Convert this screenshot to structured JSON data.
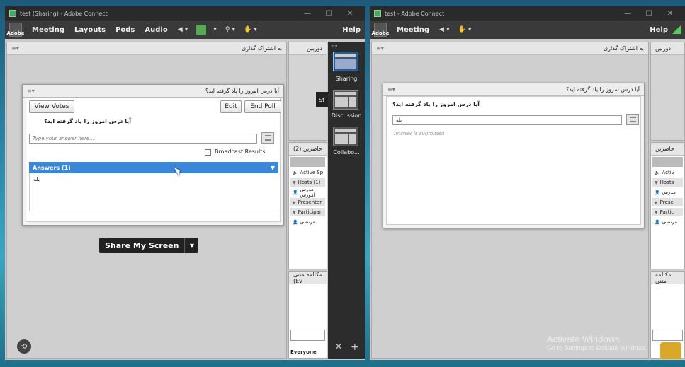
{
  "left_window": {
    "title": "test (Sharing) - Adobe Connect",
    "menu": [
      "Meeting",
      "Layouts",
      "Pods",
      "Audio"
    ],
    "help": "Help",
    "share_pod_title": "به اشتراک گذاری",
    "video_pod_title": "دوربين",
    "poll": {
      "title": "آیا درس امروز را یاد گرفته اید؟",
      "view_votes": "View Votes",
      "edit": "Edit",
      "end_poll": "End Poll",
      "question": "آیا درس امروز را یاد گرفته اید؟",
      "answer_placeholder": "Type your answer here...",
      "broadcast": "Broadcast Results",
      "answers_header": "Answers (1)",
      "answer_1": "بله"
    },
    "share_my_screen": "Share My Screen",
    "layouts": [
      {
        "label": "Sharing"
      },
      {
        "label": "Discussion"
      },
      {
        "label": "Collabo..."
      }
    ],
    "attendees": {
      "title": "حاضرين  (2)",
      "active_speakers": "Active Sp",
      "hosts": "Hosts (1)",
      "host_name": "مدرس اموزش",
      "presenters": "Presenter",
      "participants": "Participan",
      "participant_name": "مرتضی"
    },
    "chat": {
      "title": "مکالمه متنی (Ev",
      "everyone": "Everyone"
    }
  },
  "right_window": {
    "title": "test - Adobe Connect",
    "menu": [
      "Meeting"
    ],
    "help": "Help",
    "share_pod_title": "به اشتراک گذاری",
    "video_pod_title": "دوربين",
    "poll": {
      "title": "آیا درس امروز را یاد گرفته اید؟",
      "question": "آیا درس امروز را یاد گرفته اید؟",
      "answer_value": "بله",
      "submitted": "Answer is submitted"
    },
    "attendees": {
      "title": "حاضرين",
      "active": "Activ",
      "hosts": "Hosts",
      "host_name": "مدرس",
      "presenters": "Prese",
      "participants": "Partic",
      "participant_name": "مرتضی"
    },
    "chat_title": "مکالمه متنی"
  },
  "watermark": {
    "line1": "Activate Windows",
    "line2": "Go to Settings to activate Windows."
  },
  "colors": {
    "accent": "#3a86d8",
    "dark": "#2a2a2a"
  }
}
